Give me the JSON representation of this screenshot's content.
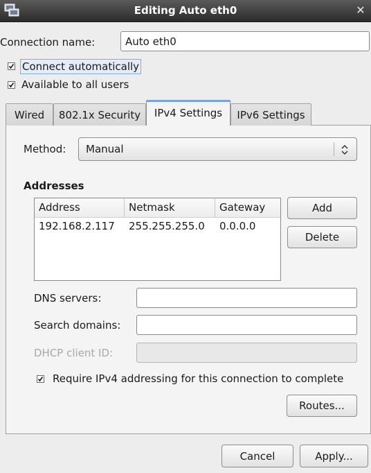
{
  "window": {
    "title": "Editing Auto eth0"
  },
  "connection": {
    "name_label": "Connection name:",
    "name_value": "Auto eth0",
    "connect_auto_label": "Connect automatically",
    "connect_auto_checked": true,
    "all_users_label": "Available to all users",
    "all_users_checked": true
  },
  "tabs": [
    {
      "label": "Wired",
      "active": false
    },
    {
      "label": "802.1x Security",
      "active": false
    },
    {
      "label": "IPv4 Settings",
      "active": true
    },
    {
      "label": "IPv6 Settings",
      "active": false
    }
  ],
  "ipv4": {
    "method_label": "Method:",
    "method_value": "Manual",
    "addresses_heading": "Addresses",
    "columns": [
      "Address",
      "Netmask",
      "Gateway"
    ],
    "rows": [
      [
        "192.168.2.117",
        "255.255.255.0",
        "0.0.0.0"
      ]
    ],
    "add_label": "Add",
    "delete_label": "Delete",
    "dns_label": "DNS servers:",
    "dns_value": "",
    "search_label": "Search domains:",
    "search_value": "",
    "dhcp_label": "DHCP client ID:",
    "dhcp_value": "",
    "require_label": "Require IPv4 addressing for this connection to complete",
    "require_checked": true,
    "routes_label": "Routes..."
  },
  "footer": {
    "cancel_label": "Cancel",
    "apply_label": "Apply..."
  }
}
